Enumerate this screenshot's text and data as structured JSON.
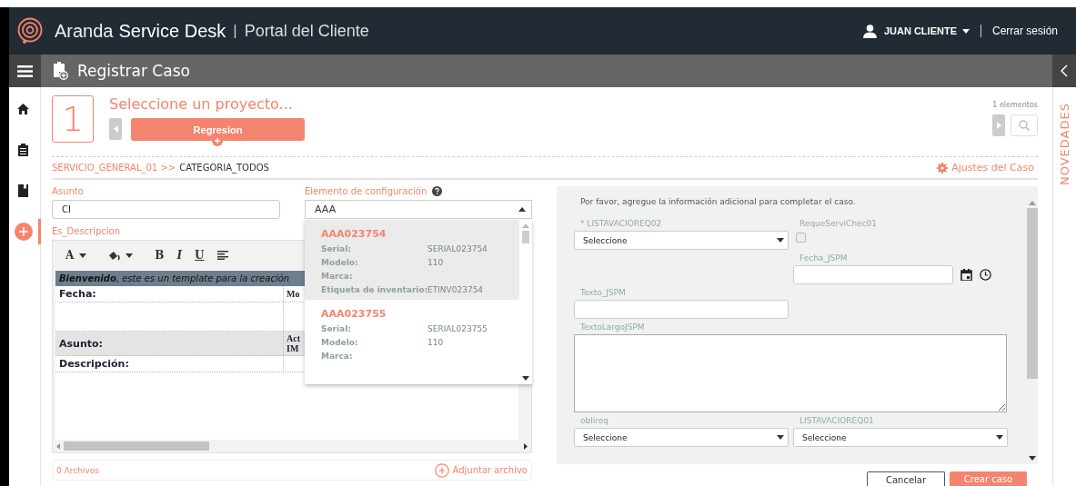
{
  "header": {
    "brand_light": "Aranda",
    "brand_bold": "Service Desk",
    "separator": "|",
    "portal": "Portal del Cliente",
    "user": "JUAN CLIENTE",
    "logout": "Cerrar sesión"
  },
  "title_bar": {
    "title": "Registrar Caso"
  },
  "rail": [
    {
      "kind": "home",
      "selected": false
    },
    {
      "kind": "clipboard",
      "selected": false
    },
    {
      "kind": "book",
      "selected": false
    },
    {
      "kind": "add",
      "selected": true
    }
  ],
  "step": {
    "number": "1",
    "title": "Seleccione un proyecto...",
    "project": "Regresion",
    "count": "1 elementos"
  },
  "breadcrumb": {
    "parent": "SERVICIO_GENERAL_01 >>",
    "current": "CATEGORIA_TODOS"
  },
  "settings_link": "Ajustes del Caso",
  "subject": {
    "label": "Asunto",
    "value": "CI"
  },
  "ci": {
    "label": "Elemento de configuración",
    "value": "AAA",
    "expanded": true,
    "options": [
      {
        "code": "AAA023754",
        "selected": true,
        "fields": [
          {
            "label": "Serial:",
            "value": "SERIAL023754"
          },
          {
            "label": "Modelo:",
            "value": "110"
          },
          {
            "label": "Marca:"
          },
          {
            "label": "Etiqueta de inventario:",
            "value": "ETINV023754"
          }
        ]
      },
      {
        "code": "AAA023755",
        "selected": false,
        "fields": [
          {
            "label": "Serial:",
            "value": "SERIAL023755"
          },
          {
            "label": "Modelo:",
            "value": "110"
          },
          {
            "label": "Marca:"
          }
        ]
      }
    ]
  },
  "description": {
    "label": "Es_Descripcion",
    "toolbar": [
      {
        "kind": "font-color",
        "label": "A"
      },
      {
        "kind": "fill"
      },
      {
        "kind": "bold",
        "label": "B"
      },
      {
        "kind": "italic",
        "label": "I"
      },
      {
        "kind": "underline",
        "label": "U"
      },
      {
        "kind": "align"
      }
    ],
    "banner": "**Bienvenido**, este es un template para la creación",
    "rows": [
      {
        "label": "Fecha:",
        "value": "Mo",
        "shaded": false
      },
      {
        "label": "",
        "value": "",
        "shaded": false
      },
      {
        "label": "Asunto:",
        "value": "Act IM",
        "shaded": true
      },
      {
        "label": "Descripción:",
        "value": "",
        "shaded": false
      }
    ]
  },
  "attachments": {
    "count": "0 Archivos",
    "action": "Adjuntar archivo"
  },
  "extra": {
    "intro": "Por favor, agregue la información adicional para completar el caso.",
    "fields": [
      {
        "kind": "select",
        "label": "* LISTAVACIOREQ02",
        "value": "Seleccione"
      },
      {
        "kind": "checkbox",
        "label": "RequeServiChec01",
        "checked": false
      },
      {
        "kind": "datetime",
        "label": "Fecha_JSPM"
      },
      {
        "kind": "text",
        "label": "Texto_JSPM"
      },
      {
        "kind": "textarea",
        "label": "TextoLargoJSPM"
      },
      {
        "kind": "select",
        "label": "oblireq",
        "value": "Seleccione"
      },
      {
        "kind": "select",
        "label": "LISTAVACIOREQ01",
        "value": "Seleccione"
      }
    ]
  },
  "buttons": {
    "cancel": "Cancelar",
    "create": "Crear caso"
  },
  "news_tab": "NOVEDADES"
}
